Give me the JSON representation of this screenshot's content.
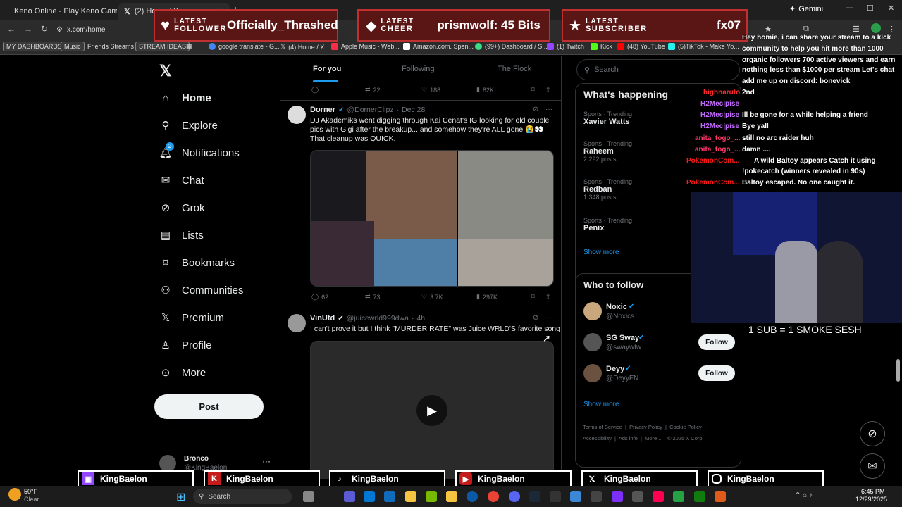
{
  "browser": {
    "tabs": [
      {
        "label": "Keno Online - Play Keno Game"
      },
      {
        "label": "(2) Home / X"
      }
    ],
    "url": "x.com/home",
    "gemini": "Gemini",
    "bookmarks": [
      "MY DASHBOARDS",
      "Music",
      "Friends Streams",
      "STREAM IDEAS",
      "google translate - G...",
      "(4) Home / X",
      "Apple Music - Web...",
      "Amazon.com. Spen...",
      "(99+) Dashboard / S...",
      "(1) Twitch",
      "Kick",
      "(48) YouTube",
      "(5)TikTok - Make Yo..."
    ]
  },
  "overlay": {
    "follower": {
      "label1": "LATEST",
      "label2": "FOLLOWER",
      "value": "Officially_Thrashed"
    },
    "cheer": {
      "label1": "LATEST",
      "label2": "CHEER",
      "value": "prismwolf: 45 Bits"
    },
    "subscriber": {
      "label1": "LATEST",
      "label2": "SUBSCRIBER",
      "value": "fx07"
    },
    "sub_text": "1 SUB = 1 SMOKE SESH",
    "chat_lines": [
      "Hey homie, i can share your stream to a kick",
      "community to help you hit more than 1000",
      "organic followers 700 active viewers and earn",
      "nothing less than $1000 per stream Let's chat",
      "add me up on discord: bonevick",
      "2nd",
      "Ill be gone for a while helping a friend",
      "Bye yall",
      "still no arc raider huh",
      "damn ....",
      "A wild Baltoy appears  Catch it using",
      "!pokecatch (winners revealed in 90s)",
      "Baltoy escaped. No one caught it."
    ],
    "chat_users": [
      "highnaruto",
      "H2Mec|pise",
      "H2Mec|pise",
      "H2Mec|pise",
      "anita_togo_...",
      "anita_togo_...",
      "PokemonCom...",
      "PokemonCom..."
    ],
    "socials": [
      "KingBaelon",
      "KingBaelon",
      "KingBaelon",
      "KingBaelon",
      "KingBaelon",
      "KingBaelon"
    ]
  },
  "x": {
    "nav": [
      "Home",
      "Explore",
      "Notifications",
      "Chat",
      "Grok",
      "Lists",
      "Bookmarks",
      "Communities",
      "Premium",
      "Profile",
      "More"
    ],
    "notif_badge": "2",
    "post_button": "Post",
    "account": {
      "name": "Bronco",
      "handle": "@KingBaelon"
    },
    "feed_tabs": [
      "For you",
      "Following",
      "The Flock"
    ],
    "top_actions": {
      "retweets": "22",
      "likes": "188",
      "views": "82K"
    },
    "tweets": [
      {
        "name": "Dorner",
        "handle": "@DornerClipz",
        "date": "Dec 28",
        "text": "DJ Akademiks went digging through Kai Cenat's IG looking for old couple pics with Gigi after the breakup... and somehow they're ALL gone 😭👀 That cleanup was QUICK.",
        "replies": "62",
        "retweets": "73",
        "likes": "3.7K",
        "views": "297K"
      },
      {
        "name": "VinUtd",
        "handle": "@juicewrld999dwa",
        "date": "4h",
        "text": "I can't prove it but I think \"MURDER RATE\" was Juice WRLD'S favorite song"
      }
    ],
    "search_placeholder": "Search",
    "whats_happening": {
      "title": "What's happening",
      "trends": [
        {
          "cat": "Sports · Trending",
          "name": "Xavier Watts",
          "posts": ""
        },
        {
          "cat": "Sports · Trending",
          "name": "Raheem",
          "posts": "2,292 posts"
        },
        {
          "cat": "Sports · Trending",
          "name": "Redban",
          "posts": "1,348 posts"
        },
        {
          "cat": "Sports · Trending",
          "name": "Penix",
          "posts": ""
        }
      ],
      "show_more": "Show more"
    },
    "who_to_follow": {
      "title": "Who to follow",
      "accounts": [
        {
          "name": "Noxic",
          "handle": "@Noxics"
        },
        {
          "name": "SG Sway",
          "handle": "@swaywtw",
          "button": "Follow"
        },
        {
          "name": "Deyy",
          "handle": "@DeyyFN",
          "button": "Follow"
        }
      ],
      "show_more": "Show more"
    },
    "footer": [
      "Terms of Service",
      "Privacy Policy",
      "Cookie Policy",
      "Accessibility",
      "Ads info",
      "More ...",
      "© 2025 X Corp."
    ]
  },
  "taskbar": {
    "weather_temp": "50°F",
    "weather_desc": "Clear",
    "search": "Search",
    "time": "6:45 PM",
    "date": "12/29/2025"
  }
}
